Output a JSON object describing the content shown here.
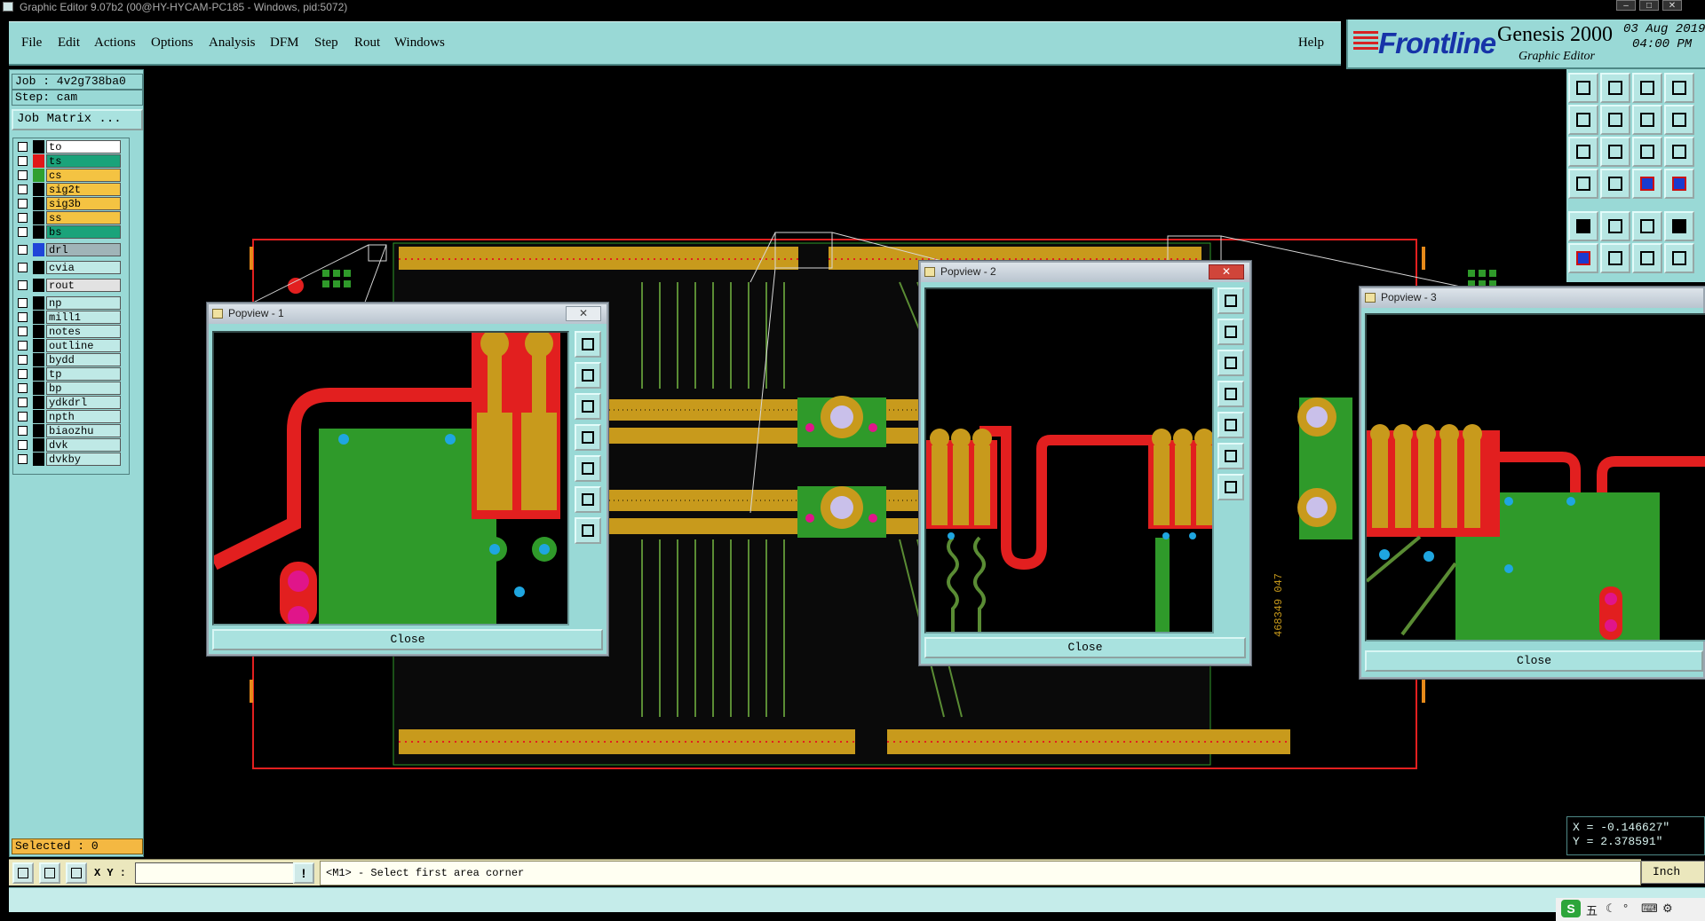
{
  "window": {
    "title": "Graphic Editor 9.07b2 (00@HY-HYCAM-PC185 - Windows, pid:5072)"
  },
  "menu": {
    "items": [
      "File",
      "Edit",
      "Actions",
      "Options",
      "Analysis",
      "DFM",
      "Step",
      "Rout",
      "Windows"
    ],
    "help": "Help"
  },
  "logo": {
    "brand": "Frontline",
    "product": "Genesis 2000",
    "subtitle": "Graphic Editor",
    "date": "03 Aug 2019",
    "time": "04:00 PM"
  },
  "job": {
    "job_label": "Job : 4v2g738ba0",
    "step_label": "Step: cam",
    "matrix_button": "Job Matrix ..."
  },
  "layers": [
    {
      "name": "to",
      "color": "#ffffff",
      "swatch": "#000000"
    },
    {
      "name": "ts",
      "color": "#1aa37a",
      "swatch": "#e01818",
      "active": true
    },
    {
      "name": "cs",
      "color": "#f4c342",
      "swatch": "#2fa02f"
    },
    {
      "name": "sig2t",
      "color": "#f4c342",
      "swatch": "#000000"
    },
    {
      "name": "sig3b",
      "color": "#f4c342",
      "swatch": "#000000"
    },
    {
      "name": "ss",
      "color": "#f4c342",
      "swatch": "#000000"
    },
    {
      "name": "bs",
      "color": "#1aa37a",
      "swatch": "#000000"
    },
    {
      "name": "drl",
      "color": "#a0b4b8",
      "swatch": "#1f44d8",
      "gap": true
    },
    {
      "name": "cvia",
      "color": "#bfe9e6",
      "swatch": "#000000",
      "gap": true
    },
    {
      "name": "rout",
      "color": "#e2e2e2",
      "swatch": "#000000",
      "gap": true
    },
    {
      "name": "np",
      "color": "#bfe9e6",
      "swatch": "#000000",
      "gap": true
    },
    {
      "name": "mill1",
      "color": "#bfe9e6",
      "swatch": "#000000"
    },
    {
      "name": "notes",
      "color": "#bfe9e6",
      "swatch": "#000000"
    },
    {
      "name": "outline",
      "color": "#bfe9e6",
      "swatch": "#000000"
    },
    {
      "name": "bydd",
      "color": "#bfe9e6",
      "swatch": "#000000"
    },
    {
      "name": "tp",
      "color": "#bfe9e6",
      "swatch": "#000000"
    },
    {
      "name": "bp",
      "color": "#bfe9e6",
      "swatch": "#000000"
    },
    {
      "name": "ydkdrl",
      "color": "#bfe9e6",
      "swatch": "#000000"
    },
    {
      "name": "npth",
      "color": "#bfe9e6",
      "swatch": "#000000"
    },
    {
      "name": "biaozhu",
      "color": "#bfe9e6",
      "swatch": "#000000"
    },
    {
      "name": "dvk",
      "color": "#bfe9e6",
      "swatch": "#000000"
    },
    {
      "name": "dvkby",
      "color": "#bfe9e6",
      "swatch": "#000000"
    }
  ],
  "selected": "Selected : 0",
  "popviews": [
    {
      "title": "Popview - 1",
      "close": "Close"
    },
    {
      "title": "Popview - 2",
      "close": "Close"
    },
    {
      "title": "Popview - 3",
      "close": "Close"
    }
  ],
  "board": {
    "silk_text": "468349 047"
  },
  "coords": {
    "x": "X = -0.146627\"",
    "y": "Y = 2.378591\""
  },
  "units": "Inch",
  "bottom": {
    "xy_label": "X Y :",
    "xy_value": "",
    "bang": "!",
    "message": "<M1> - Select first area corner"
  },
  "tray": {
    "ime": "S",
    "wu": "五"
  },
  "colors": {
    "panel": "#99d9d6",
    "copper": "#e21f1f",
    "pad": "#c89a1c",
    "mask": "#2f9a2a",
    "trace": "#5a8c34",
    "outline": "#ffffff"
  }
}
